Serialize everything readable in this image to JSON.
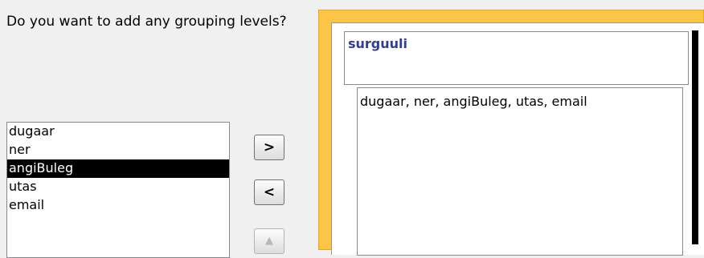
{
  "wizard": {
    "question": "Do you want to add any grouping levels?",
    "fields": [
      "dugaar",
      "ner",
      "angiBuleg",
      "utas",
      "email"
    ],
    "selected_field": "angiBuleg",
    "buttons": {
      "add": ">",
      "remove": "<",
      "up": "▲"
    }
  },
  "preview": {
    "group_label": "surguuli",
    "detail_fields": "dugaar, ner, angiBuleg, utas, email"
  }
}
